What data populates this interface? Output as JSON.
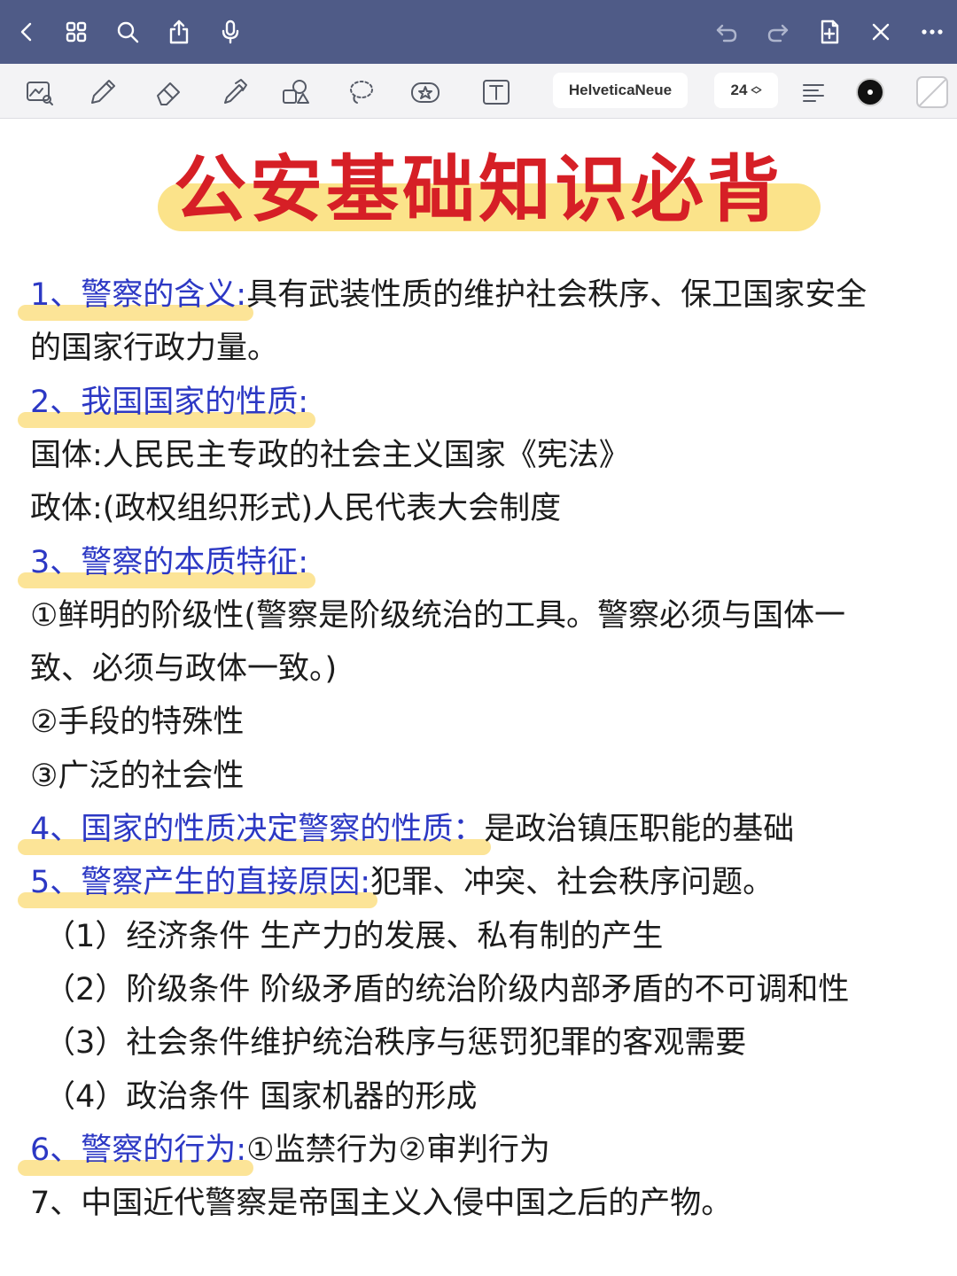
{
  "colors": {
    "topbar_bg": "#4f5b87",
    "toolbar_bg": "#f3f3f5",
    "title_red": "#d61f26",
    "heading_blue": "#2c38c4",
    "highlight_yellow": "#fce497"
  },
  "topbar": {
    "left_icons": [
      "back-icon",
      "grid-icon",
      "search-icon",
      "share-icon",
      "microphone-icon"
    ],
    "right_icons": [
      "undo-icon",
      "redo-icon",
      "add-page-icon",
      "close-icon",
      "more-icon"
    ]
  },
  "toolbar": {
    "tools": [
      "image-lasso-icon",
      "pen-icon",
      "eraser-icon",
      "highlighter-icon",
      "shapes-icon",
      "lasso-icon",
      "sticker-icon",
      "text-tool-icon"
    ],
    "font_name": "HelveticaNeue",
    "font_size": "24"
  },
  "note": {
    "title": "公安基础知识必背",
    "items": [
      {
        "heading": "1、警察的含义:",
        "text": "具有武装性质的维护社会秩序、保卫国家安全"
      },
      {
        "text": "的国家行政力量。"
      },
      {
        "heading": "2、我国国家的性质:",
        "text": ""
      },
      {
        "text": "国体:人民民主专政的社会主义国家《宪法》"
      },
      {
        "text": "政体:(政权组织形式)人民代表大会制度"
      },
      {
        "heading": "3、警察的本质特征:",
        "text": ""
      },
      {
        "text": "①鲜明的阶级性(警察是阶级统治的工具。警察必须与国体一"
      },
      {
        "text": "致、必须与政体一致。)"
      },
      {
        "text": "②手段的特殊性"
      },
      {
        "text": "③广泛的社会性"
      },
      {
        "heading": "4、国家的性质决定警察的性质：",
        "text": "是政治镇压职能的基础"
      },
      {
        "heading": "5、警察产生的直接原因:",
        "text": "犯罪、冲突、社会秩序问题。"
      },
      {
        "text": "（1）经济条件 生产力的发展、私有制的产生",
        "indent": true
      },
      {
        "text": "（2）阶级条件 阶级矛盾的统治阶级内部矛盾的不可调和性",
        "indent": true
      },
      {
        "text": "（3）社会条件维护统治秩序与惩罚犯罪的客观需要",
        "indent": true
      },
      {
        "text": "（4）政治条件 国家机器的形成",
        "indent": true
      },
      {
        "heading": "6、警察的行为:",
        "text": "①监禁行为②审判行为"
      },
      {
        "text": "7、中国近代警察是帝国主义入侵中国之后的产物。"
      }
    ]
  }
}
